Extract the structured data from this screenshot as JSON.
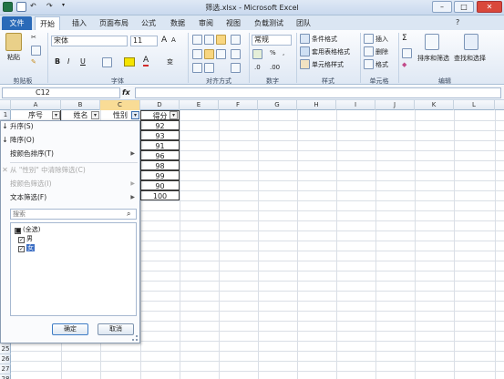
{
  "window": {
    "title": "筛选.xlsx - Microsoft Excel",
    "controls": [
      "–",
      "□",
      "✕"
    ]
  },
  "tabs": [
    "文件",
    "开始",
    "插入",
    "页面布局",
    "公式",
    "数据",
    "审阅",
    "视图",
    "负载测试",
    "团队"
  ],
  "ribbon": {
    "clipboard": {
      "paste": "粘贴",
      "label": "剪贴板"
    },
    "font": {
      "name": "宋体",
      "size": "11",
      "grow": "A",
      "shrink": "A",
      "bold": "B",
      "italic": "I",
      "underline": "U",
      "phonetic": "变",
      "label": "字体"
    },
    "alignment": {
      "label": "对齐方式"
    },
    "number": {
      "format": "常规",
      "percent": "%",
      "comma": ",",
      "label": "数字"
    },
    "styles": {
      "conditional": "条件格式",
      "table": "套用表格格式",
      "cell": "单元格样式",
      "label": "样式"
    },
    "cells": {
      "insert": "插入",
      "delete": "删除",
      "format": "格式",
      "label": "单元格"
    },
    "editing": {
      "sigma": "Σ",
      "sort": "排序和筛选",
      "find": "查找和选择",
      "label": "编辑"
    }
  },
  "formula_bar": {
    "name_box": "C12",
    "fx": "fx",
    "value": ""
  },
  "columns": [
    "A",
    "B",
    "C",
    "D",
    "E",
    "F",
    "G",
    "H",
    "I",
    "J",
    "K",
    "L"
  ],
  "row_numbers_top": [
    "1"
  ],
  "row_numbers_bottom": [
    "25",
    "26",
    "27",
    "28"
  ],
  "headers": {
    "a": "序号",
    "b": "姓名",
    "c": "性别",
    "d": "得分"
  },
  "scores": [
    "92",
    "93",
    "91",
    "96",
    "98",
    "99",
    "90",
    "100"
  ],
  "dropdown": {
    "sort_asc": "升序(S)",
    "sort_desc": "降序(O)",
    "sort_color": "按颜色排序(T)",
    "clear_filter": "从 \"性别\" 中清除筛选(C)",
    "filter_color": "按颜色筛选(I)",
    "text_filter": "文本筛选(F)",
    "search_placeholder": "搜索",
    "items": [
      "(全选)",
      "男",
      "女"
    ],
    "ok": "确定",
    "cancel": "取消"
  }
}
